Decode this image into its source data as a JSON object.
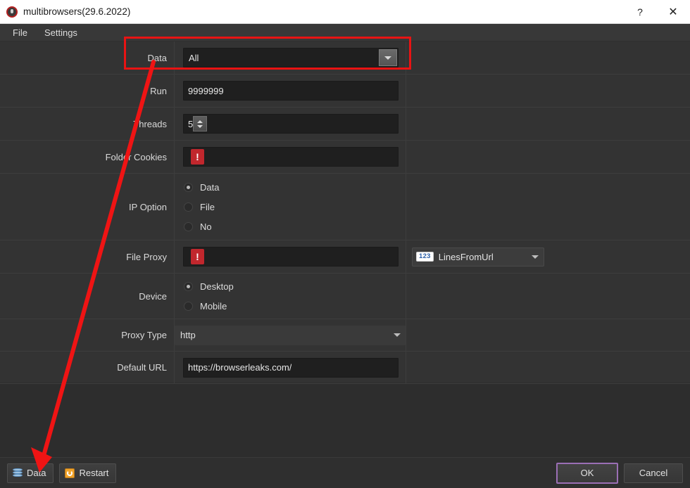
{
  "window": {
    "title": "multibrowsers(29.6.2022)",
    "app_icon": "app-circle-icon",
    "help_label": "?",
    "close_label": "✕"
  },
  "menubar": {
    "items": [
      {
        "label": "File"
      },
      {
        "label": "Settings"
      }
    ]
  },
  "form": {
    "rows": [
      {
        "label": "Data",
        "type": "combo-dark",
        "value": "All",
        "name": "data-select"
      },
      {
        "label": "Run",
        "type": "text",
        "value": "9999999",
        "name": "run-input"
      },
      {
        "label": "Threads",
        "type": "spinner",
        "value": "5",
        "name": "threads-input"
      },
      {
        "label": "Folder Cookies",
        "type": "text-error",
        "value": "",
        "error_icon": "error-exclamation-icon",
        "name": "folder-cookies-input"
      },
      {
        "label": "IP Option",
        "type": "radio",
        "name": "ip-option-radio-group",
        "options": [
          {
            "label": "Data",
            "selected": true
          },
          {
            "label": "File",
            "selected": false
          },
          {
            "label": "No",
            "selected": false
          }
        ]
      },
      {
        "label": "File Proxy",
        "type": "text-error-extra",
        "value": "",
        "error_icon": "error-exclamation-icon",
        "name": "file-proxy-input",
        "extra": {
          "type": "combo-badge",
          "badge": "123",
          "value": "LinesFromUrl",
          "name": "file-proxy-mode-select"
        }
      },
      {
        "label": "Device",
        "type": "radio",
        "name": "device-radio-group",
        "options": [
          {
            "label": "Desktop",
            "selected": true
          },
          {
            "label": "Mobile",
            "selected": false
          }
        ]
      },
      {
        "label": "Proxy Type",
        "type": "combo-flat",
        "value": "http",
        "name": "proxy-type-select"
      },
      {
        "label": "Default URL",
        "type": "text",
        "value": "https://browserleaks.com/",
        "name": "default-url-input"
      }
    ]
  },
  "bottombar": {
    "data_label": "Data",
    "data_icon": "database-icon",
    "restart_label": "Restart",
    "restart_icon": "restart-icon",
    "ok_label": "OK",
    "cancel_label": "Cancel"
  },
  "annotations": {
    "highlight_color": "#e81313",
    "arrow_color": "#ef1414"
  }
}
